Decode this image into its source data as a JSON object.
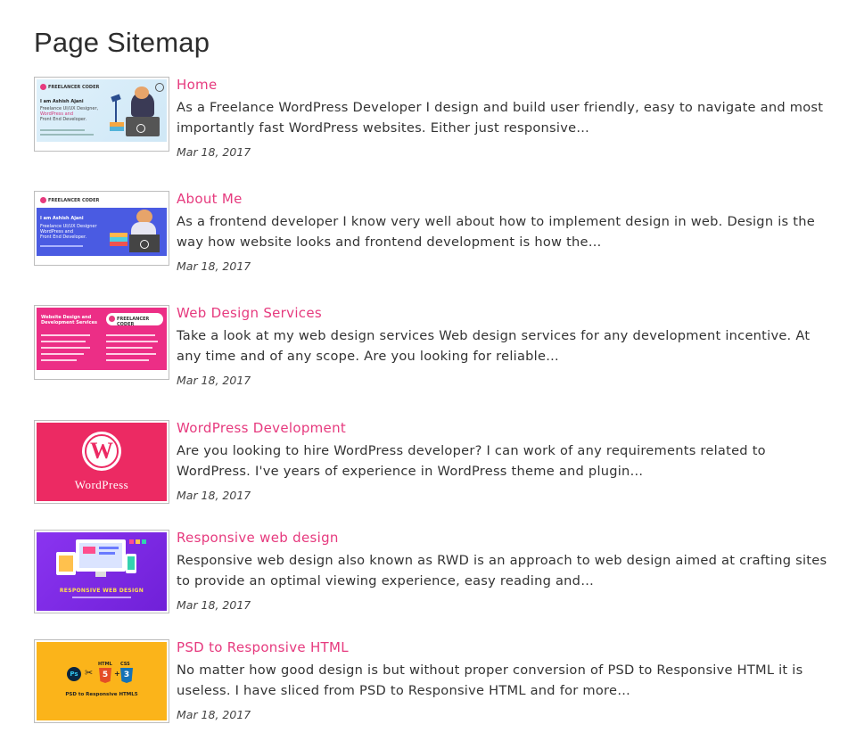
{
  "page": {
    "title": "Page Sitemap"
  },
  "items": [
    {
      "title": "Home",
      "excerpt": "As a Freelance WordPress Developer I design and build user friendly, easy to navigate and most importantly fast WordPress websites. Either just responsive…",
      "date": "Mar 18, 2017",
      "thumb": {
        "brand": "FREELANCER CODER",
        "line1": "I am Ashish Ajani",
        "line2": "Freelance UI/UX Designer,",
        "line3": "WordPress and",
        "line4": "Front End Developer."
      }
    },
    {
      "title": "About Me",
      "excerpt": "As a frontend developer I know very well about how to implement design in web. Design is the way how website looks and frontend development is how the…",
      "date": "Mar 18, 2017",
      "thumb": {
        "brand": "FREELANCER CODER",
        "line1": "I am Ashish Ajani",
        "line2": "Freelance UI/UX Designer",
        "line3": "WordPress and",
        "line4": "Front End Developer."
      }
    },
    {
      "title": "Web Design Services",
      "excerpt": "Take a look at my web design services Web design services for any development incentive. At any time and of any scope. Are you looking for reliable…",
      "date": "Mar 18, 2017",
      "thumb": {
        "brand": "FREELANCER CODER",
        "heading1": "Website Design and",
        "heading2": "Development Services"
      }
    },
    {
      "title": "WordPress Development",
      "excerpt": "Are you looking to hire WordPress developer? I can work of any requirements related to WordPress. I've years of experience in WordPress theme and plugin…",
      "date": "Mar 18, 2017",
      "thumb": {
        "logo": "W",
        "wordmark": "WordPress"
      }
    },
    {
      "title": "Responsive web design",
      "excerpt": "Responsive web design also known as RWD is an approach to web design aimed at crafting sites to provide an optimal viewing experience, easy reading and…",
      "date": "Mar 18, 2017",
      "thumb": {
        "label": "RESPONSIVE WEB DESIGN"
      }
    },
    {
      "title": "PSD to Responsive HTML",
      "excerpt": "No matter how good design is but without proper conversion of PSD to Responsive HTML it is useless. I have sliced from PSD to Responsive HTML and for more…",
      "date": "Mar 18, 2017",
      "thumb": {
        "ps": "Ps",
        "html": "HTML",
        "css": "CSS",
        "label": "PSD to Responsive HTML5"
      }
    }
  ],
  "colors": {
    "link": "#e63a7e",
    "text": "#333333"
  }
}
